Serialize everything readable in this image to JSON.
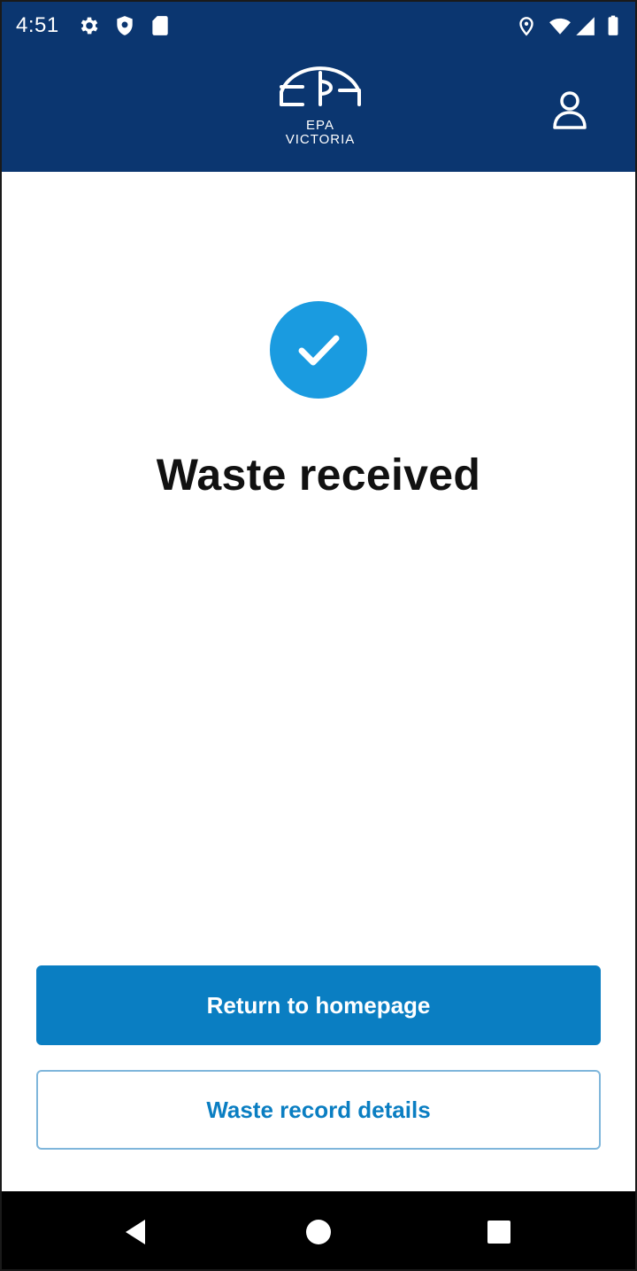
{
  "status_bar": {
    "time": "4:51",
    "left_icons": [
      "settings-icon",
      "shield-icon",
      "sd-card-icon"
    ],
    "right_icons": [
      "location-icon",
      "wifi-icon",
      "signal-icon",
      "battery-icon"
    ]
  },
  "header": {
    "logo": {
      "mark": "EPA",
      "line1": "EPA",
      "line2": "VICTORIA"
    },
    "profile_icon": "user-icon",
    "background_color": "#0b3670"
  },
  "main": {
    "status_icon": "checkmark-circle-icon",
    "status_icon_color": "#1a9be0",
    "title": "Waste received"
  },
  "actions": {
    "primary_label": "Return to homepage",
    "secondary_label": "Waste record details",
    "accent_color": "#0a7ec2"
  },
  "nav_bar": {
    "buttons": [
      "back-icon",
      "home-icon",
      "recents-icon"
    ]
  }
}
